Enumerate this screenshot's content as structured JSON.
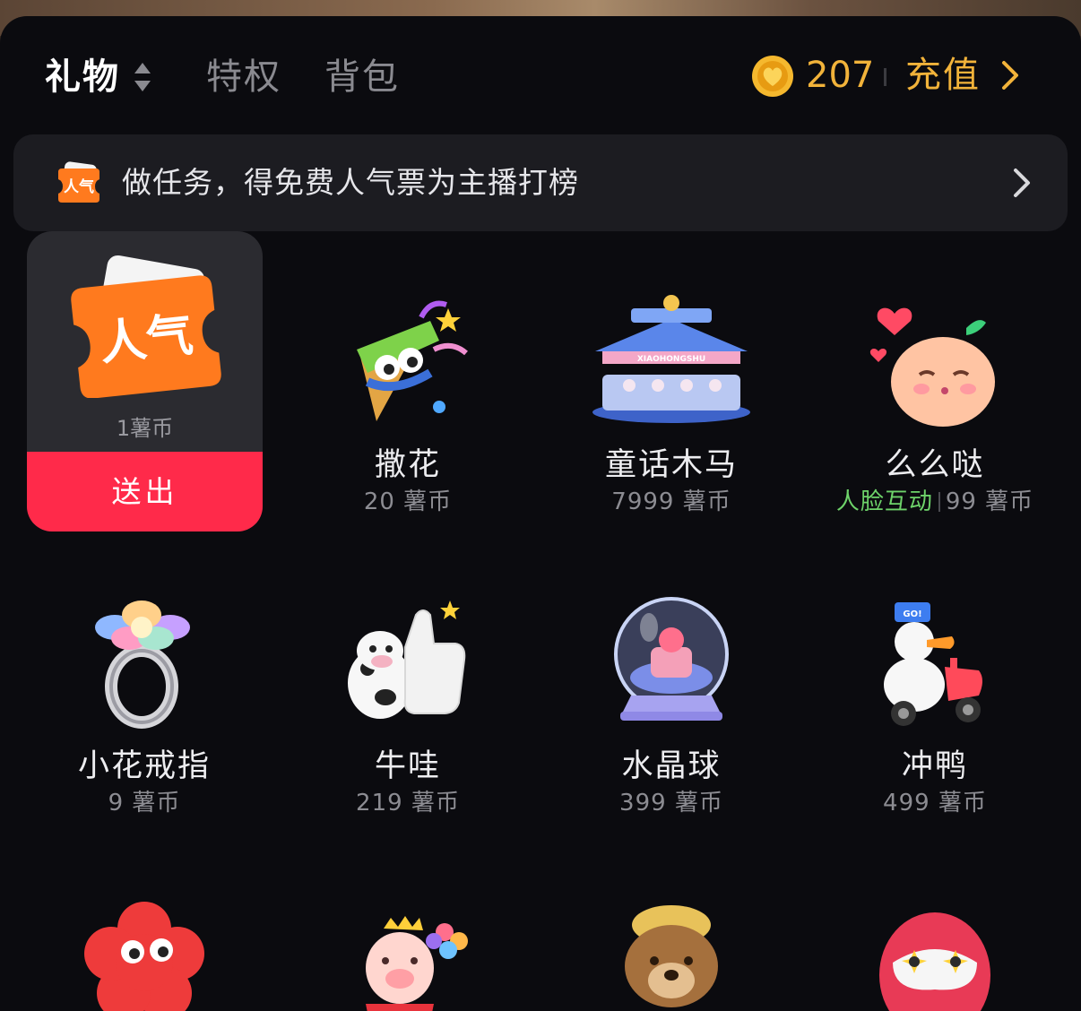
{
  "header": {
    "tabs": [
      {
        "label": "礼物",
        "active": true
      },
      {
        "label": "特权",
        "active": false
      },
      {
        "label": "背包",
        "active": false
      }
    ],
    "coin_balance": "207",
    "recharge_label": "充值"
  },
  "banner": {
    "icon_text": "人气",
    "text": "做任务，得免费人气票为主播打榜"
  },
  "selected_gift": {
    "icon_text": "人气",
    "price": "1薯币",
    "send_label": "送出"
  },
  "gifts": [
    {
      "name": "撒花",
      "price": "20 薯币"
    },
    {
      "name": "童话木马",
      "price": "7999 薯币",
      "sign_text": "XIAOHONGSHU"
    },
    {
      "name": "么么哒",
      "tag": "人脸互动",
      "price": "99 薯币"
    },
    {
      "name": "小花戒指",
      "price": "9 薯币"
    },
    {
      "name": "牛哇",
      "price": "219 薯币"
    },
    {
      "name": "水晶球",
      "price": "399 薯币"
    },
    {
      "name": "冲鸭",
      "price": "499 薯币",
      "badge_text": "GO!"
    }
  ],
  "colors": {
    "panel_bg": "#0b0b0f",
    "accent_gold": "#f2b33a",
    "send_red": "#ff2a4a",
    "tag_green": "#6ed36a",
    "muted_text": "#8c8c92"
  }
}
